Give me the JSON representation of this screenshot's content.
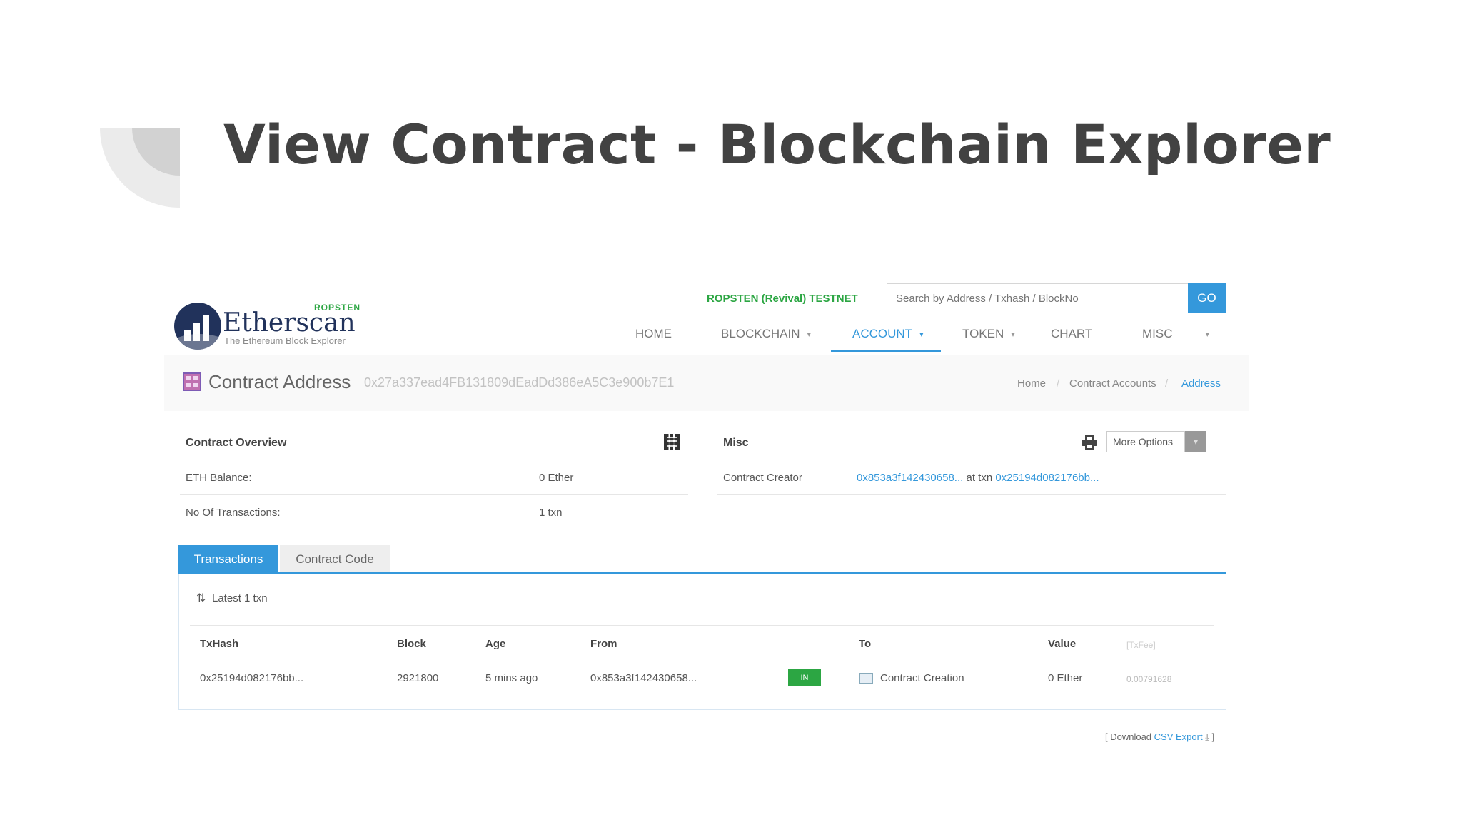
{
  "slide": {
    "title": "View Contract - Blockchain Explorer"
  },
  "header": {
    "logo_network": "ROPSTEN",
    "logo_name": "Etherscan",
    "logo_tagline": "The Ethereum Block Explorer",
    "testnet_label": "ROPSTEN (Revival) TESTNET",
    "search_placeholder": "Search by Address / Txhash / BlockNo",
    "go_label": "GO",
    "nav": [
      "HOME",
      "BLOCKCHAIN",
      "ACCOUNT",
      "TOKEN",
      "CHART",
      "MISC"
    ],
    "active_nav": "ACCOUNT"
  },
  "subheader": {
    "label": "Contract Address",
    "address": "0x27a337ead4FB131809dEadDd386eA5C3e900b7E1",
    "breadcrumb": [
      "Home",
      "Contract Accounts",
      "Address"
    ]
  },
  "overview": {
    "title": "Contract Overview",
    "eth_balance_label": "ETH Balance:",
    "eth_balance_value": "0 Ether",
    "tx_count_label": "No Of Transactions:",
    "tx_count_value": "1 txn"
  },
  "misc": {
    "title": "Misc",
    "more_options": "More Options",
    "creator_label": "Contract Creator",
    "creator_address": "0x853a3f142430658...",
    "at_txn": "at txn",
    "creator_tx": "0x25194d082176bb..."
  },
  "tabs": {
    "transactions": "Transactions",
    "contract_code": "Contract Code"
  },
  "table": {
    "latest": "Latest 1 txn",
    "headers": [
      "TxHash",
      "Block",
      "Age",
      "From",
      "To",
      "Value",
      "[TxFee]"
    ],
    "rows": [
      {
        "txhash": "0x25194d082176bb...",
        "block": "2921800",
        "age": "5 mins ago",
        "from": "0x853a3f142430658...",
        "direction": "IN",
        "to": "Contract Creation",
        "value": "0 Ether",
        "fee": "0.00791628"
      }
    ]
  },
  "csv": {
    "prefix": "[ Download",
    "link": "CSV Export",
    "suffix": "]"
  },
  "colors": {
    "accent": "#3498db",
    "testnet_green": "#2ca643",
    "logo_navy": "#21325b"
  },
  "icons": [
    "qr-code-icon",
    "print-icon",
    "sort-icon",
    "contract-icon",
    "download-icon"
  ]
}
